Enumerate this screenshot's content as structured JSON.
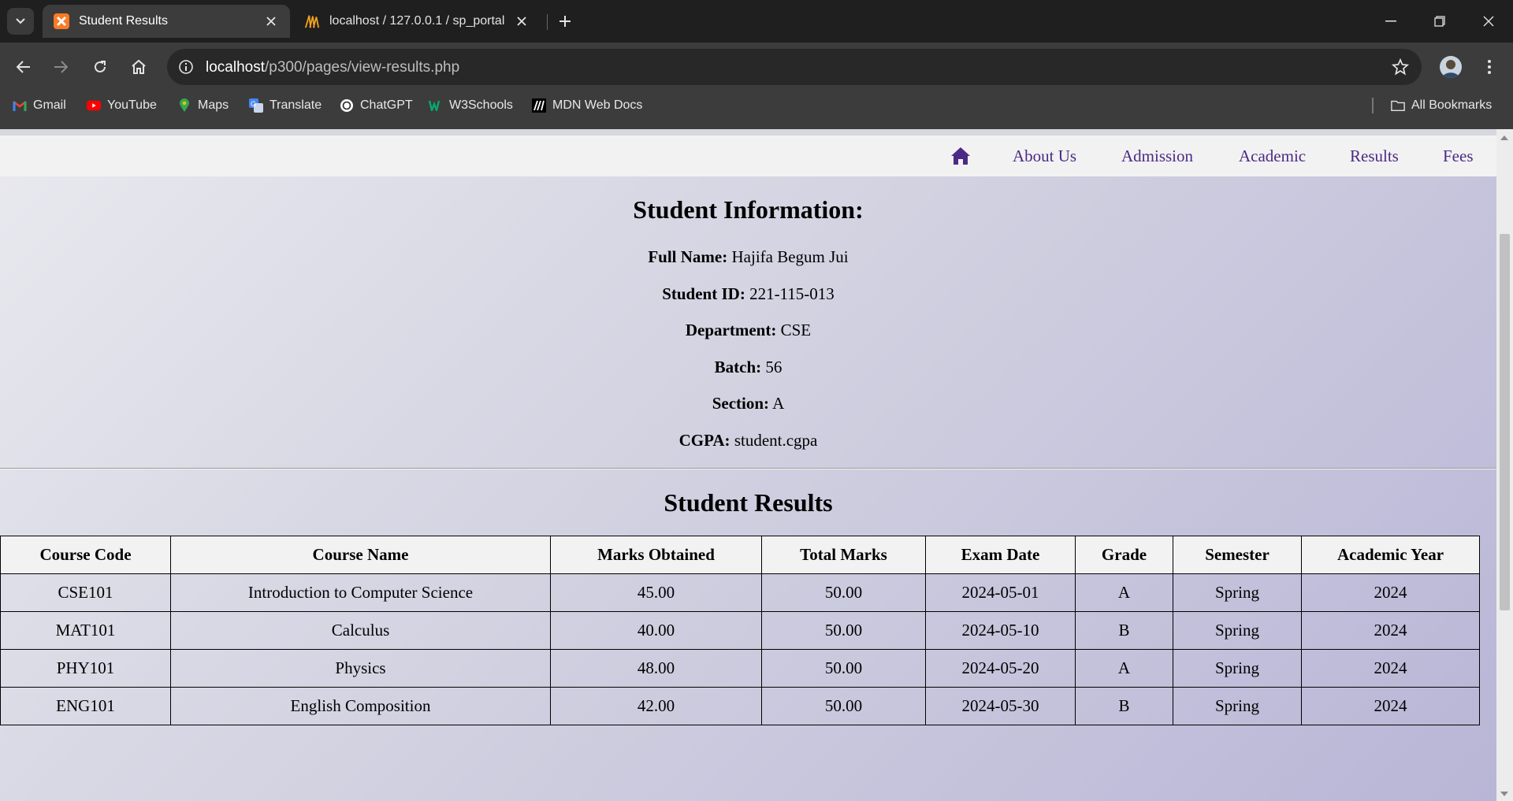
{
  "browser": {
    "tabs": [
      {
        "title": "Student Results",
        "active": true
      },
      {
        "title": "localhost / 127.0.0.1 / sp_portal",
        "active": false
      }
    ],
    "url_host": "localhost",
    "url_path": "/p300/pages/view-results.php",
    "bookmarks": [
      {
        "label": "Gmail",
        "icon": "gmail-icon"
      },
      {
        "label": "YouTube",
        "icon": "youtube-icon"
      },
      {
        "label": "Maps",
        "icon": "maps-icon"
      },
      {
        "label": "Translate",
        "icon": "translate-icon"
      },
      {
        "label": "ChatGPT",
        "icon": "chatgpt-icon"
      },
      {
        "label": "W3Schools",
        "icon": "w3schools-icon"
      },
      {
        "label": "MDN Web Docs",
        "icon": "mdn-icon"
      }
    ],
    "all_bookmarks": "All Bookmarks"
  },
  "nav": {
    "items": [
      "About Us",
      "Admission",
      "Academic",
      "Results",
      "Fees"
    ],
    "accent": "#4b2a85"
  },
  "student_info": {
    "title": "Student Information:",
    "fields": [
      {
        "label": "Full Name:",
        "value": "Hajifa Begum Jui"
      },
      {
        "label": "Student ID:",
        "value": "221-115-013"
      },
      {
        "label": "Department:",
        "value": "CSE"
      },
      {
        "label": "Batch:",
        "value": "56"
      },
      {
        "label": "Section:",
        "value": "A"
      },
      {
        "label": "CGPA:",
        "value": "student.cgpa"
      }
    ]
  },
  "results": {
    "title": "Student Results",
    "columns": [
      "Course Code",
      "Course Name",
      "Marks Obtained",
      "Total Marks",
      "Exam Date",
      "Grade",
      "Semester",
      "Academic Year"
    ],
    "rows": [
      [
        "CSE101",
        "Introduction to Computer Science",
        "45.00",
        "50.00",
        "2024-05-01",
        "A",
        "Spring",
        "2024"
      ],
      [
        "MAT101",
        "Calculus",
        "40.00",
        "50.00",
        "2024-05-10",
        "B",
        "Spring",
        "2024"
      ],
      [
        "PHY101",
        "Physics",
        "48.00",
        "50.00",
        "2024-05-20",
        "A",
        "Spring",
        "2024"
      ],
      [
        "ENG101",
        "English Composition",
        "42.00",
        "50.00",
        "2024-05-30",
        "B",
        "Spring",
        "2024"
      ]
    ]
  }
}
